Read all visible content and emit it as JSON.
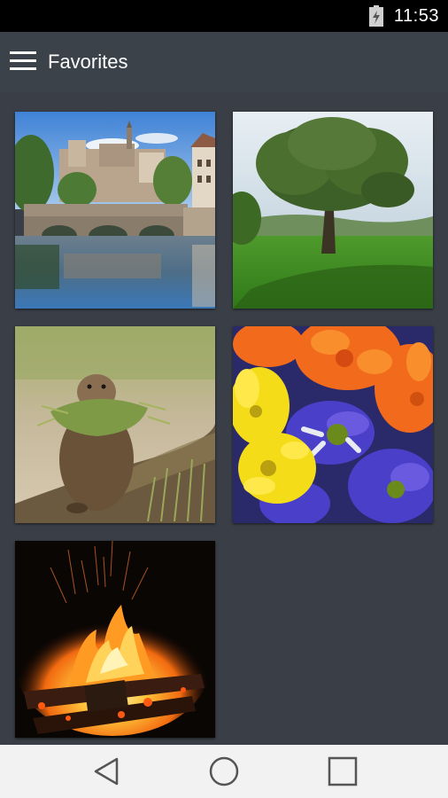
{
  "status_bar": {
    "time": "11:53",
    "battery_icon": "battery-charging-icon"
  },
  "app_bar": {
    "title": "Favorites",
    "menu_icon": "hamburger-menu-icon"
  },
  "gallery": {
    "items": [
      {
        "subject": "river-town-bridge"
      },
      {
        "subject": "tree-meadow"
      },
      {
        "subject": "gopher-with-grass"
      },
      {
        "subject": "colorful-daisies"
      },
      {
        "subject": "campfire"
      }
    ]
  },
  "nav_bar": {
    "back_icon": "back-triangle-icon",
    "home_icon": "home-circle-icon",
    "recents_icon": "recents-square-icon"
  }
}
